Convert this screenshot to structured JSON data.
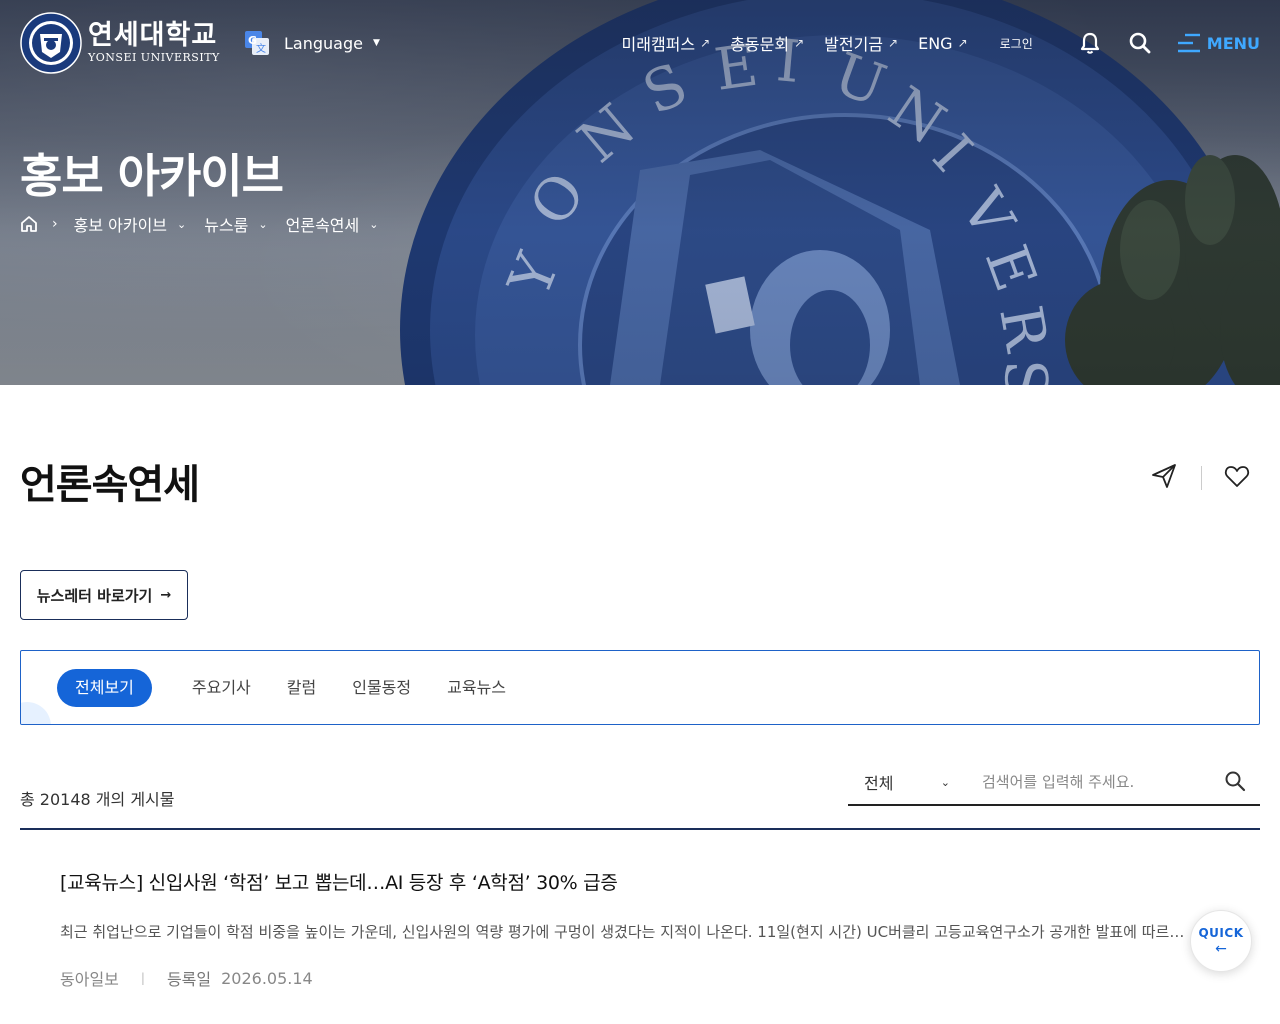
{
  "header": {
    "logo_ko": "연세대학교",
    "logo_en": "YONSEI UNIVERSITY",
    "language_label": "Language",
    "nav": [
      {
        "label": "미래캠퍼스"
      },
      {
        "label": "총동문회"
      },
      {
        "label": "발전기금"
      },
      {
        "label": "ENG"
      }
    ],
    "login_label": "로그인",
    "menu_label": "MENU"
  },
  "hero": {
    "title": "홍보 아카이브",
    "breadcrumb": [
      {
        "label": "홍보 아카이브"
      },
      {
        "label": "뉴스룸"
      },
      {
        "label": "언론속연세"
      }
    ]
  },
  "page": {
    "title": "언론속연세",
    "newsletter_label": "뉴스레터 바로가기"
  },
  "tabs": [
    {
      "label": "전체보기",
      "active": true
    },
    {
      "label": "주요기사"
    },
    {
      "label": "칼럼"
    },
    {
      "label": "인물동정"
    },
    {
      "label": "교육뉴스"
    }
  ],
  "list": {
    "count_text": "총 20148 개의 게시물",
    "search": {
      "category_selected": "전체",
      "placeholder": "검색어를 입력해 주세요."
    }
  },
  "articles": [
    {
      "title": "[교육뉴스] 신입사원 ‘학점’ 보고 뽑는데…AI 등장 후 ‘A학점’ 30% 급증",
      "summary": "최근 취업난으로 기업들이 학점 비중을 높이는 가운데, 신입사원의 역량 평가에 구멍이 생겼다는 지적이 나온다. 11일(현지 시간) UC버클리 고등교육연구소가 공개한 발표에 따르면, 성적 인플레이션",
      "source": "동아일보",
      "date_label": "등록일",
      "date": "2026.05.14"
    }
  ],
  "quick": {
    "label": "QUICK"
  },
  "colors": {
    "accent": "#1565d8",
    "navy": "#1a2e5a",
    "menu": "#3fa8ff"
  }
}
